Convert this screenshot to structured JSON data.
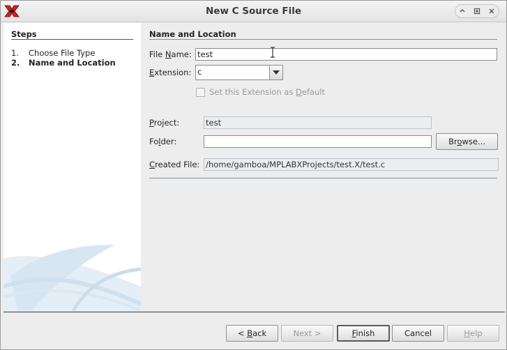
{
  "window": {
    "title": "New C Source File",
    "controls": [
      "minimize-icon",
      "maximize-icon",
      "close-icon"
    ]
  },
  "steps": {
    "heading": "Steps",
    "items": [
      {
        "number": "1.",
        "label": "Choose File Type",
        "current": false
      },
      {
        "number": "2.",
        "label": "Name and Location",
        "current": true
      }
    ]
  },
  "section": {
    "heading": "Name and Location"
  },
  "file_name": {
    "label_pre": "File ",
    "label_u": "N",
    "label_post": "ame:",
    "value": "test"
  },
  "extension": {
    "label_u": "E",
    "label_post": "xtension:",
    "value": "c"
  },
  "default_checkbox": {
    "label_pre": "Set this Extension as ",
    "label_u": "D",
    "label_post": "efault",
    "checked": false,
    "enabled": false
  },
  "project": {
    "label_u": "P",
    "label_post": "roject:",
    "value": "test"
  },
  "folder": {
    "label_pre": "Fo",
    "label_u": "l",
    "label_post": "der:",
    "value": "",
    "browse_pre": "Br",
    "browse_u": "o",
    "browse_post": "wse..."
  },
  "created_file": {
    "label_u": "C",
    "label_post": "reated File:",
    "value": "/home/gamboa/MPLABXProjects/test.X/test.c"
  },
  "buttons": {
    "back_pre": "< ",
    "back_u": "B",
    "back_post": "ack",
    "next": "Next >",
    "finish_u": "F",
    "finish_post": "inish",
    "cancel": "Cancel",
    "help_u": "H",
    "help_post": "elp"
  },
  "colors": {
    "accent_rule": "#7f8ea3",
    "app_icon": "#cc2222"
  }
}
